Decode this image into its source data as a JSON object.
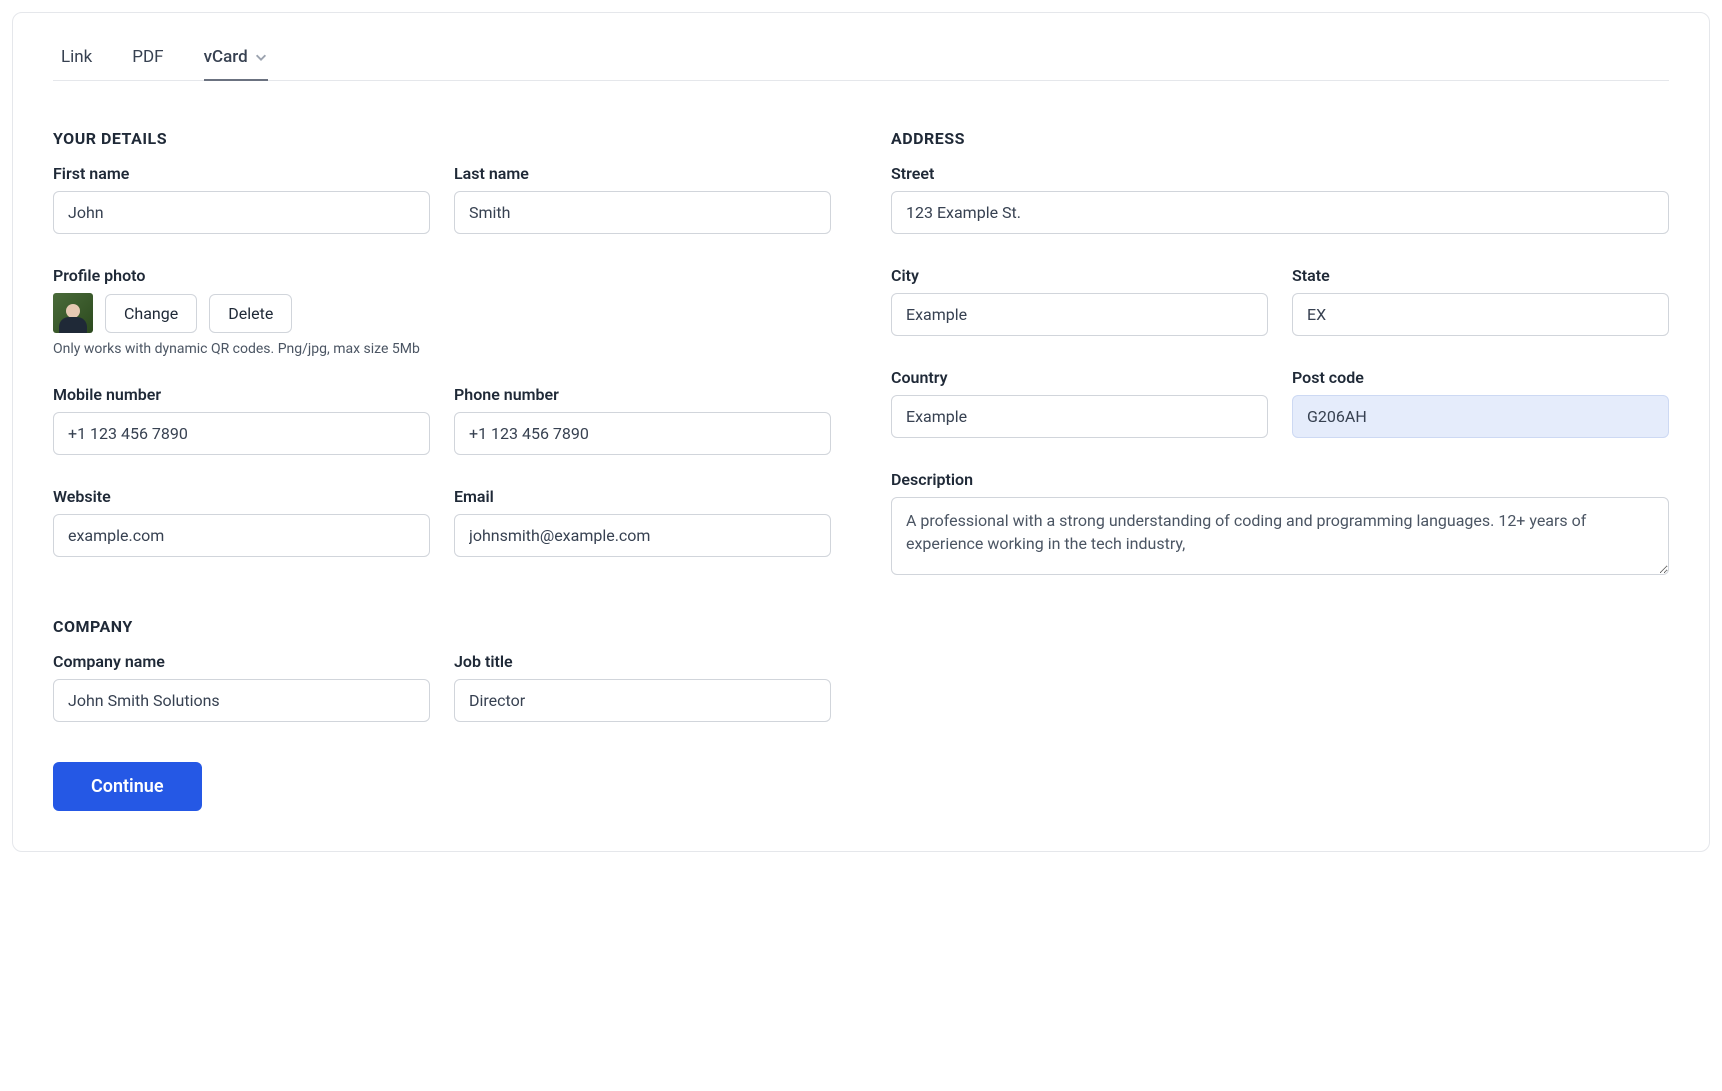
{
  "tabs": {
    "link": "Link",
    "pdf": "PDF",
    "vcard": "vCard"
  },
  "details": {
    "title": "YOUR DETAILS",
    "first_name_label": "First name",
    "first_name": "John",
    "last_name_label": "Last name",
    "last_name": "Smith",
    "photo_label": "Profile photo",
    "change_label": "Change",
    "delete_label": "Delete",
    "photo_hint": "Only works with dynamic QR codes. Png/jpg, max size 5Mb",
    "mobile_label": "Mobile number",
    "mobile": "+1 123 456 7890",
    "phone_label": "Phone number",
    "phone": "+1 123 456 7890",
    "website_label": "Website",
    "website": "example.com",
    "email_label": "Email",
    "email": "johnsmith@example.com"
  },
  "company": {
    "title": "COMPANY",
    "name_label": "Company name",
    "name": "John Smith Solutions",
    "job_label": "Job title",
    "job": "Director"
  },
  "address": {
    "title": "ADDRESS",
    "street_label": "Street",
    "street": "123 Example St.",
    "city_label": "City",
    "city": "Example",
    "state_label": "State",
    "state": "EX",
    "country_label": "Country",
    "country": "Example",
    "post_label": "Post code",
    "post": "G206AH",
    "description_label": "Description",
    "description": "A professional with a strong understanding of coding and programming languages. 12+ years of experience working in the tech industry,"
  },
  "actions": {
    "continue": "Continue"
  }
}
